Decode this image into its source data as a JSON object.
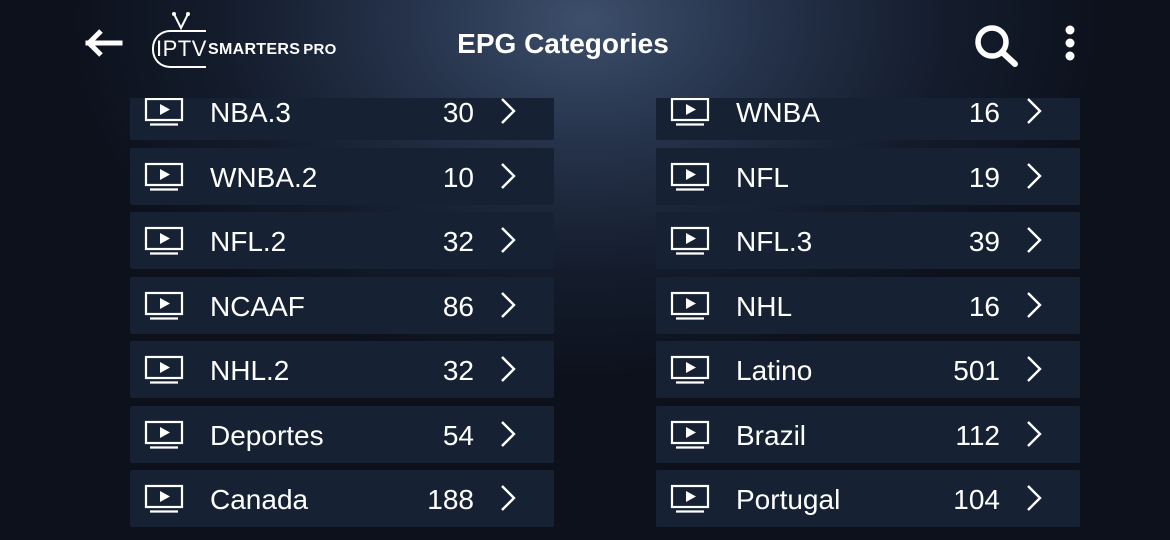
{
  "header": {
    "title": "EPG Categories",
    "logo": {
      "iptv": "IPTV",
      "smarters": "SMARTERS",
      "pro": "PRO"
    }
  },
  "icons": {
    "back": "back-arrow-icon",
    "search": "search-icon",
    "more": "more-vertical-icon",
    "category": "tv-play-icon",
    "chevron": "chevron-right-icon"
  },
  "categories_left": [
    {
      "name": "NBA.3",
      "count": "30"
    },
    {
      "name": "WNBA.2",
      "count": "10"
    },
    {
      "name": "NFL.2",
      "count": "32"
    },
    {
      "name": "NCAAF",
      "count": "86"
    },
    {
      "name": "NHL.2",
      "count": "32"
    },
    {
      "name": "Deportes",
      "count": "54"
    },
    {
      "name": "Canada",
      "count": "188"
    }
  ],
  "categories_right": [
    {
      "name": "WNBA",
      "count": "16"
    },
    {
      "name": "NFL",
      "count": "19"
    },
    {
      "name": "NFL.3",
      "count": "39"
    },
    {
      "name": "NHL",
      "count": "16"
    },
    {
      "name": "Latino",
      "count": "501"
    },
    {
      "name": "Brazil",
      "count": "112"
    },
    {
      "name": "Portugal",
      "count": "104"
    }
  ]
}
